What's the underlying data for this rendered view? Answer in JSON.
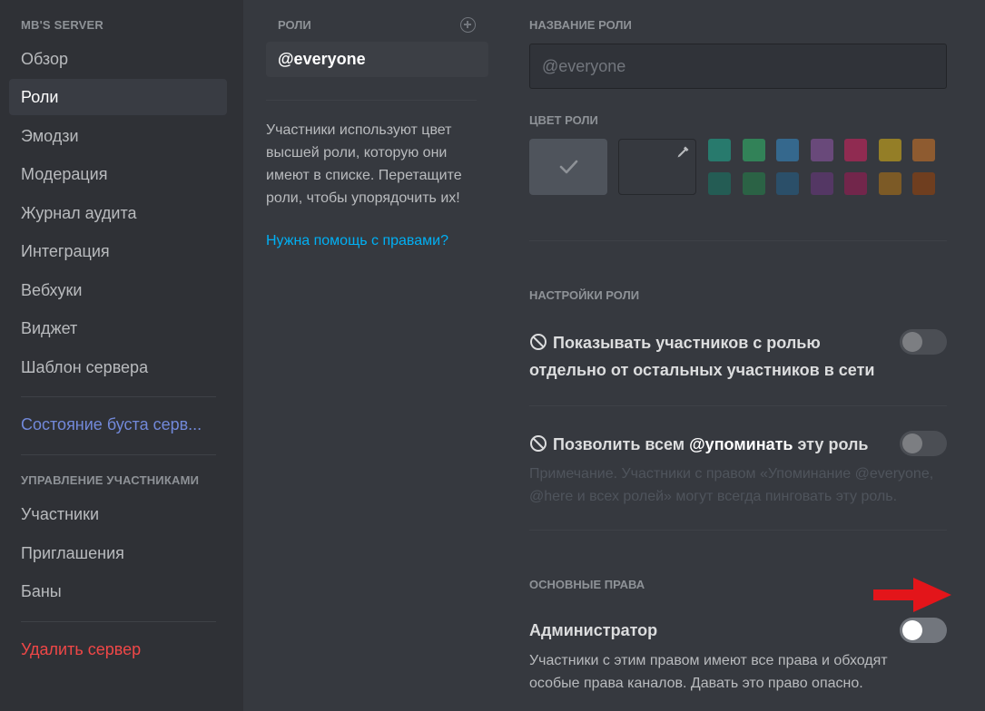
{
  "sidebar": {
    "server_header": "MB'S SERVER",
    "items": [
      {
        "label": "Обзор"
      },
      {
        "label": "Роли"
      },
      {
        "label": "Эмодзи"
      },
      {
        "label": "Модерация"
      },
      {
        "label": "Журнал аудита"
      },
      {
        "label": "Интеграция"
      },
      {
        "label": "Вебхуки"
      },
      {
        "label": "Виджет"
      },
      {
        "label": "Шаблон сервера"
      }
    ],
    "boost_status": "Состояние буста серв...",
    "members_section_header": "УПРАВЛЕНИЕ УЧАСТНИКАМИ",
    "member_items": [
      {
        "label": "Участники"
      },
      {
        "label": "Приглашения"
      },
      {
        "label": "Баны"
      }
    ],
    "delete_server": "Удалить сервер"
  },
  "roles": {
    "header": "РОЛИ",
    "selected_role": "@everyone",
    "description": "Участники используют цвет высшей роли, которую они имеют в списке. Перетащите роли, чтобы упорядочить их!",
    "help_link": "Нужна помощь с правами?"
  },
  "role_editor": {
    "name_label": "НАЗВАНИЕ РОЛИ",
    "name_placeholder": "@everyone",
    "color_label": "ЦВЕТ РОЛИ",
    "swatches_row1": [
      "#1abc9c",
      "#2ecc71",
      "#3498db",
      "#9b59b6",
      "#e91e63",
      "#f1c40f",
      "#e67e22"
    ],
    "swatches_row2": [
      "#11806a",
      "#1f8b4c",
      "#206694",
      "#71368a",
      "#ad1457",
      "#c27c0e",
      "#a84300"
    ],
    "settings_label": "НАСТРОЙКИ РОЛИ",
    "setting_hoist_line1": "Показывать участников с ролью",
    "setting_hoist_line2": "отдельно от остальных участников в сети",
    "setting_mention_prefix": "Позволить всем ",
    "setting_mention_bold": "@упоминать",
    "setting_mention_suffix": " эту роль",
    "mention_note_line1": "Примечание. Участники с правом «Упоминание @everyone,",
    "mention_note_line2": "@here и всех ролей» могут всегда пинговать эту роль.",
    "general_perms_label": "ОСНОВНЫЕ ПРАВА",
    "admin_title": "Администратор",
    "admin_desc_line1": "Участники с этим правом имеют все права и обходят",
    "admin_desc_line2": "особые права каналов. Давать это право опасно."
  },
  "colors": {
    "accent_link": "#00b0f4",
    "danger": "#f04747",
    "boost": "#7289da",
    "annotation_arrow": "#e3151a"
  },
  "icons": [
    "add-circle-icon",
    "checkmark-icon",
    "eyedropper-icon",
    "ban-icon",
    "red-arrow-icon"
  ]
}
